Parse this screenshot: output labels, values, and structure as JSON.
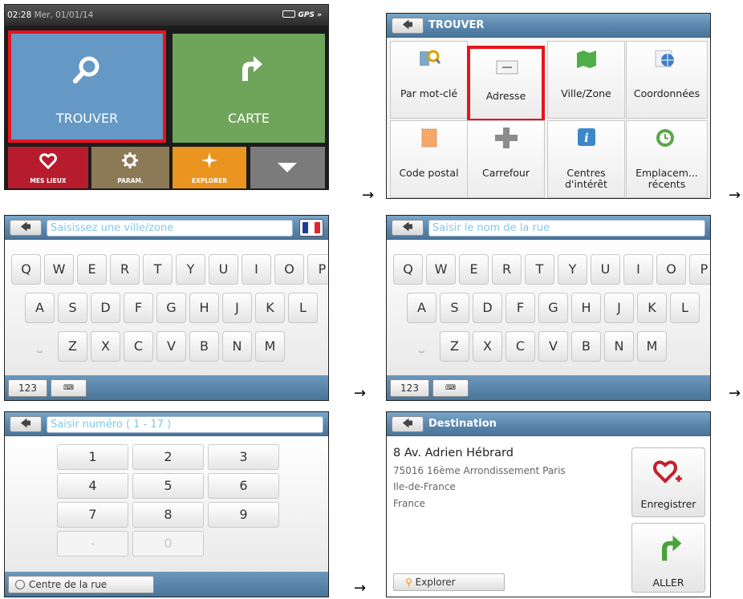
{
  "screen1": {
    "status_time": "02:28",
    "status_date": "Mer, 01/01/14",
    "status_gps": "GPS",
    "trouver_label": "TROUVER",
    "carte_label": "CARTE",
    "meslieux_label": "MES LIEUX",
    "param_label": "PARAM.",
    "explorer_label": "EXPLORER",
    "colors": {
      "trouver": "#6598c5",
      "carte": "#6fa55b",
      "meslieux": "#b71c2d",
      "param": "#8c7a57",
      "explorer": "#e9951f",
      "more": "#7b7b7b",
      "highlight": "#e8141c"
    }
  },
  "screen2": {
    "title": "TROUVER",
    "items": [
      {
        "label": "Par mot-clé",
        "icon": "keyword-search-icon"
      },
      {
        "label": "Adresse",
        "icon": "address-card-icon"
      },
      {
        "label": "Ville/Zone",
        "icon": "city-map-icon"
      },
      {
        "label": "Coordonnées",
        "icon": "coordinates-globe-icon"
      },
      {
        "label": "Code postal",
        "icon": "postal-stamp-icon"
      },
      {
        "label": "Carrefour",
        "icon": "crossroad-icon"
      },
      {
        "label": "Centres\nd'intérêt",
        "icon": "info-icon"
      },
      {
        "label": "Emplacem...\nrécents",
        "icon": "recent-clock-icon"
      }
    ]
  },
  "screen3": {
    "placeholder": "Saisissez une ville/zone",
    "row1": [
      "Q",
      "W",
      "E",
      "R",
      "T",
      "Y",
      "U",
      "I",
      "O",
      "P"
    ],
    "row2": [
      "A",
      "S",
      "D",
      "F",
      "G",
      "H",
      "J",
      "K",
      "L"
    ],
    "row3": [
      "Z",
      "X",
      "C",
      "V",
      "B",
      "N",
      "M"
    ],
    "num_label": "123"
  },
  "screen4": {
    "placeholder": "Saisir le nom de la rue",
    "row1": [
      "Q",
      "W",
      "E",
      "R",
      "T",
      "Y",
      "U",
      "I",
      "O",
      "P"
    ],
    "row2": [
      "A",
      "S",
      "D",
      "F",
      "G",
      "H",
      "J",
      "K",
      "L"
    ],
    "row3": [
      "Z",
      "X",
      "C",
      "V",
      "B",
      "N",
      "M"
    ],
    "num_label": "123"
  },
  "screen5": {
    "placeholder": "Saisir numéro ( 1 - 17 )",
    "keys": [
      "1",
      "2",
      "3",
      "4",
      "5",
      "6",
      "7",
      "8",
      "9",
      "-",
      "0"
    ],
    "center_label": "Centre de la rue"
  },
  "screen6": {
    "title": "Destination",
    "street": "8 Av. Adrien Hébrard",
    "line2": "75016 16ème Arrondissement Paris",
    "line3": "Ile-de-France",
    "line4": "France",
    "save_label": "Enregistrer",
    "go_label": "ALLER",
    "explore_label": "Explorer"
  },
  "arrow_glyph": "→"
}
